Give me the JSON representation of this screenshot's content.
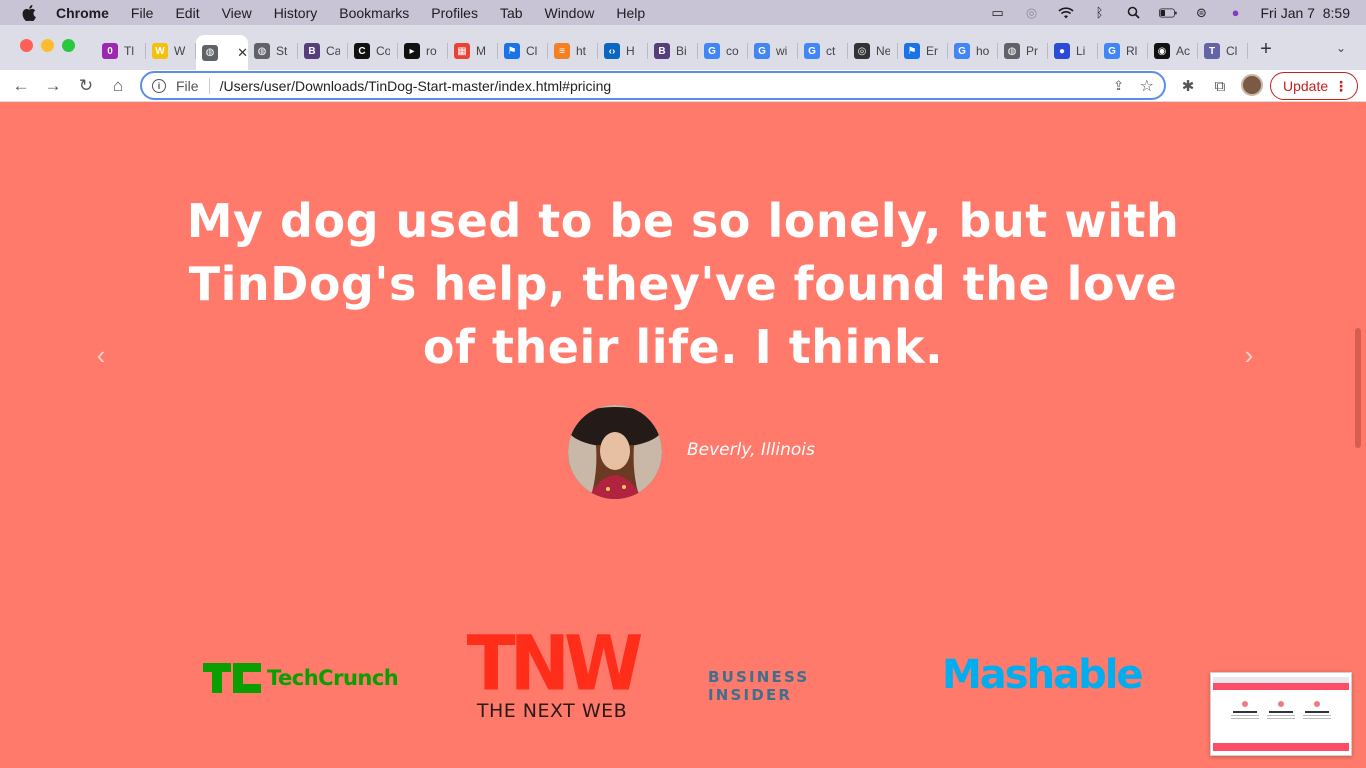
{
  "menubar": {
    "apple": "",
    "app": "Chrome",
    "items": [
      "File",
      "Edit",
      "View",
      "History",
      "Bookmarks",
      "Profiles",
      "Tab",
      "Window",
      "Help"
    ],
    "datetime": "Fri Jan 7  8:59"
  },
  "tabs": [
    {
      "label": "Tl",
      "color": "#9c27b0",
      "glyph": "0"
    },
    {
      "label": "W",
      "color": "#f4c20d",
      "glyph": "W"
    },
    {
      "label": "",
      "color": "#5f6368",
      "glyph": "◍",
      "active": true
    },
    {
      "label": "St",
      "color": "#5f6368",
      "glyph": "◍"
    },
    {
      "label": "Ca",
      "color": "#563d7c",
      "glyph": "B"
    },
    {
      "label": "Co",
      "color": "#111111",
      "glyph": "C"
    },
    {
      "label": "ro",
      "color": "#111111",
      "glyph": "▸"
    },
    {
      "label": "M",
      "color": "#ea4335",
      "glyph": "▦"
    },
    {
      "label": "Cl",
      "color": "#1a73e8",
      "glyph": "⚑"
    },
    {
      "label": "ht",
      "color": "#f48024",
      "glyph": "≡"
    },
    {
      "label": "H",
      "color": "#0a66c2",
      "glyph": "‹›"
    },
    {
      "label": "Bi",
      "color": "#563d7c",
      "glyph": "B"
    },
    {
      "label": "co",
      "color": "#4285f4",
      "glyph": "G"
    },
    {
      "label": "wi",
      "color": "#4285f4",
      "glyph": "G"
    },
    {
      "label": "ct",
      "color": "#4285f4",
      "glyph": "G"
    },
    {
      "label": "Ne",
      "color": "#333333",
      "glyph": "◎"
    },
    {
      "label": "Er",
      "color": "#1a73e8",
      "glyph": "⚑"
    },
    {
      "label": "ho",
      "color": "#4285f4",
      "glyph": "G"
    },
    {
      "label": "Pr",
      "color": "#5f6368",
      "glyph": "◍"
    },
    {
      "label": "Li",
      "color": "#2a4bd7",
      "glyph": "●"
    },
    {
      "label": "Rl",
      "color": "#4285f4",
      "glyph": "G"
    },
    {
      "label": "Ac",
      "color": "#111111",
      "glyph": "◉"
    },
    {
      "label": "Cl",
      "color": "#6264a7",
      "glyph": "T"
    }
  ],
  "toolbar": {
    "file_label": "File",
    "url": "/Users/user/Downloads/TinDog-Start-master/index.html#pricing",
    "update_label": "Update"
  },
  "testimonial": {
    "quote": "My dog used to be so lonely, but with TinDog's help, they've found the love of their life. I think.",
    "author": "Beverly, Illinois"
  },
  "press": {
    "techcrunch": "TechCrunch",
    "tnw_big": "TNW",
    "tnw_small": "THE NEXT WEB",
    "business_insider": "BUSINESS INSIDER",
    "mashable": "Mashable"
  },
  "colors": {
    "page_bg": "#ff7a6b",
    "accent": "#ff4c68",
    "update_red": "#c5221f"
  }
}
